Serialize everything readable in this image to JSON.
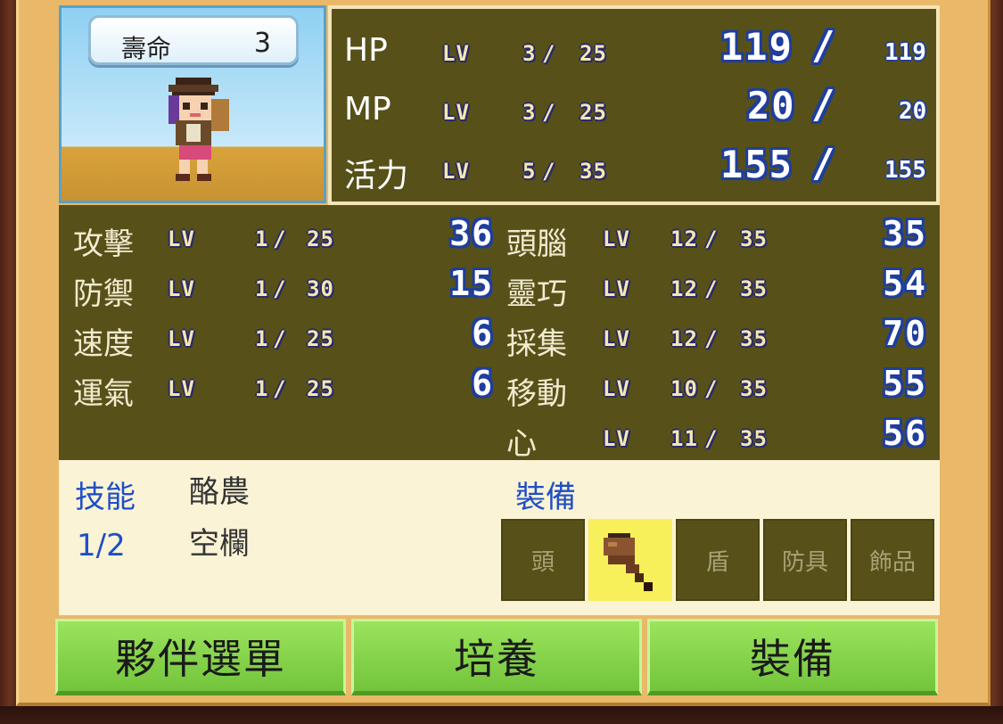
{
  "lifespan": {
    "label": "壽命",
    "value": "3"
  },
  "top_stats": [
    {
      "name": "HP",
      "lv": "LV",
      "lv_cur": "3",
      "lv_max": "25",
      "cur": "119",
      "max": "119"
    },
    {
      "name": "MP",
      "lv": "LV",
      "lv_cur": "3",
      "lv_max": "25",
      "cur": "20",
      "max": "20"
    },
    {
      "name": "活力",
      "lv": "LV",
      "lv_cur": "5",
      "lv_max": "35",
      "cur": "155",
      "max": "155"
    }
  ],
  "left_stats": [
    {
      "name": "攻擊",
      "lv": "LV",
      "lv_cur": "1",
      "lv_max": "25",
      "value": "36"
    },
    {
      "name": "防禦",
      "lv": "LV",
      "lv_cur": "1",
      "lv_max": "30",
      "value": "15"
    },
    {
      "name": "速度",
      "lv": "LV",
      "lv_cur": "1",
      "lv_max": "25",
      "value": "6"
    },
    {
      "name": "運氣",
      "lv": "LV",
      "lv_cur": "1",
      "lv_max": "25",
      "value": "6"
    }
  ],
  "right_stats": [
    {
      "name": "頭腦",
      "lv": "LV",
      "lv_cur": "12",
      "lv_max": "35",
      "value": "35"
    },
    {
      "name": "靈巧",
      "lv": "LV",
      "lv_cur": "12",
      "lv_max": "35",
      "value": "54"
    },
    {
      "name": "採集",
      "lv": "LV",
      "lv_cur": "12",
      "lv_max": "35",
      "value": "70"
    },
    {
      "name": "移動",
      "lv": "LV",
      "lv_cur": "10",
      "lv_max": "35",
      "value": "55"
    },
    {
      "name": "心",
      "lv": "LV",
      "lv_cur": "11",
      "lv_max": "35",
      "value": "56"
    }
  ],
  "skills": {
    "label": "技能",
    "count": "1/2",
    "items": [
      "酪農",
      "空欄"
    ]
  },
  "equipment": {
    "label": "裝備",
    "slots": [
      {
        "label": "頭",
        "selected": false
      },
      {
        "label": "",
        "icon": "club-weapon-icon",
        "selected": true
      },
      {
        "label": "盾",
        "selected": false
      },
      {
        "label": "防具",
        "selected": false
      },
      {
        "label": "飾品",
        "selected": false
      }
    ]
  },
  "buttons": {
    "party_menu": "夥伴選單",
    "train": "培養",
    "equip": "裝備"
  },
  "colors": {
    "panel": "#575119",
    "button": "#7fcf45",
    "accent_blue": "#1f4fc6",
    "selected_slot": "#f7f05a"
  }
}
